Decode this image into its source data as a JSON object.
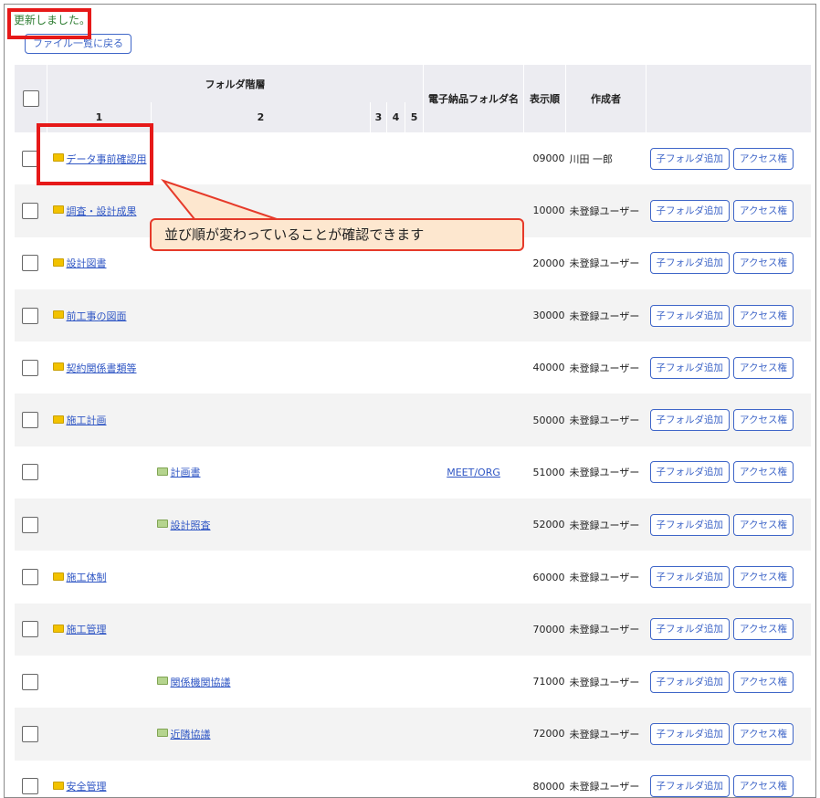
{
  "message": "更新しました。",
  "back_button": "ファイル一覧に戻る",
  "table": {
    "header_group": "フォルダ階層",
    "level_headers": [
      "1",
      "2",
      "3",
      "4",
      "5"
    ],
    "col_electronic": "電子納品フォルダ名",
    "col_order": "表示順",
    "col_author": "作成者"
  },
  "rows": [
    {
      "level": 1,
      "name": "データ事前確認用",
      "electronic": "",
      "order": "09000",
      "author": "川田 一郎"
    },
    {
      "level": 1,
      "name": "調査・設計成果",
      "electronic": "",
      "order": "10000",
      "author": "未登録ユーザー"
    },
    {
      "level": 1,
      "name": "設計図書",
      "electronic": "",
      "order": "20000",
      "author": "未登録ユーザー"
    },
    {
      "level": 1,
      "name": "前工事の図面",
      "electronic": "",
      "order": "30000",
      "author": "未登録ユーザー"
    },
    {
      "level": 1,
      "name": "契約関係書類等",
      "electronic": "",
      "order": "40000",
      "author": "未登録ユーザー"
    },
    {
      "level": 1,
      "name": "施工計画",
      "electronic": "",
      "order": "50000",
      "author": "未登録ユーザー"
    },
    {
      "level": 2,
      "name": "計画書",
      "electronic": "MEET/ORG",
      "order": "51000",
      "author": "未登録ユーザー"
    },
    {
      "level": 2,
      "name": "設計照査",
      "electronic": "",
      "order": "52000",
      "author": "未登録ユーザー"
    },
    {
      "level": 1,
      "name": "施工体制",
      "electronic": "",
      "order": "60000",
      "author": "未登録ユーザー"
    },
    {
      "level": 1,
      "name": "施工管理",
      "electronic": "",
      "order": "70000",
      "author": "未登録ユーザー"
    },
    {
      "level": 2,
      "name": "関係機関協議",
      "electronic": "",
      "order": "71000",
      "author": "未登録ユーザー"
    },
    {
      "level": 2,
      "name": "近隣協議",
      "electronic": "",
      "order": "72000",
      "author": "未登録ユーザー"
    },
    {
      "level": 1,
      "name": "安全管理",
      "electronic": "",
      "order": "80000",
      "author": "未登録ユーザー"
    }
  ],
  "actions": {
    "add_child": "子フォルダ追加",
    "access": "アクセス権"
  },
  "callout": "並び順が変わっていることが確認できます",
  "colors": {
    "link": "#2f56c4",
    "highlight": "#e61919",
    "callout_bg": "#fde7cf",
    "folder_level1": "#f2c200",
    "folder_level2": "#b5d48e"
  }
}
